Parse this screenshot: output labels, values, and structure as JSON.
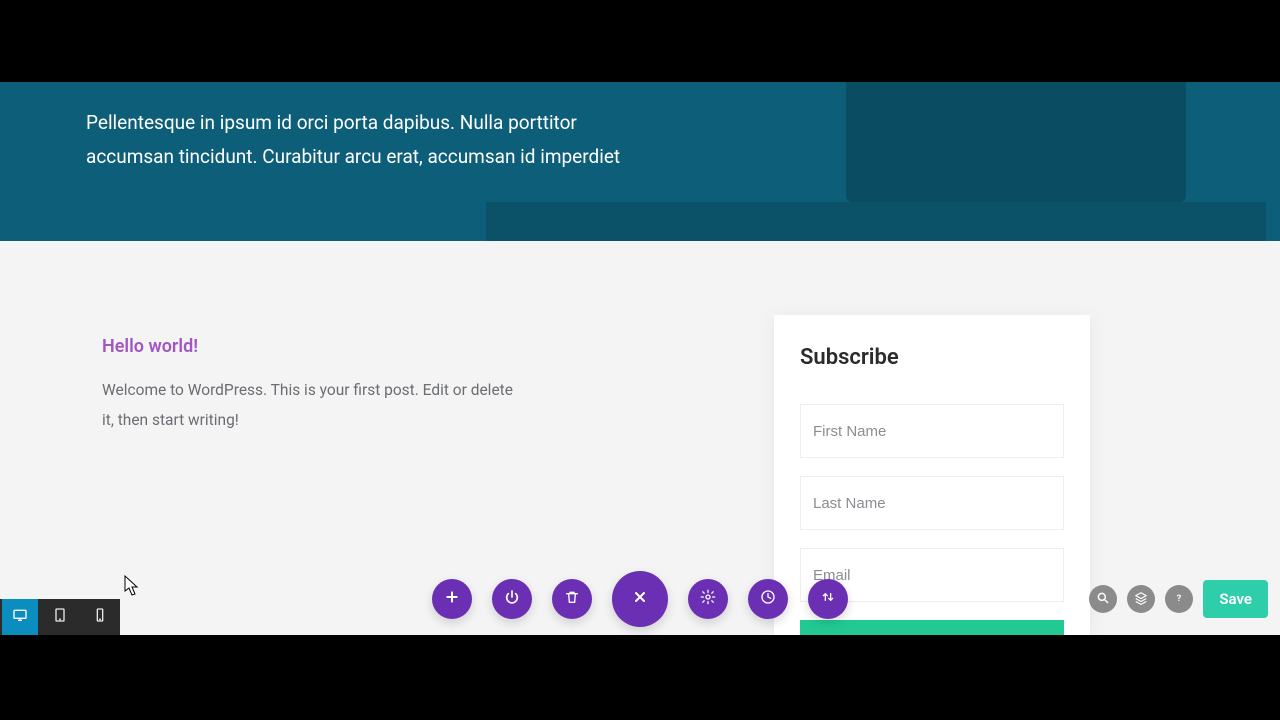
{
  "hero": {
    "paragraph": "Pellentesque in ipsum id orci porta dapibus. Nulla porttitor accumsan tincidunt. Curabitur arcu erat, accumsan id imperdiet"
  },
  "post": {
    "title": "Hello world!",
    "body": "Welcome to WordPress. This is your first post. Edit or delete it, then start writing!"
  },
  "subscribe": {
    "heading": "Subscribe",
    "fields": {
      "first_name_placeholder": "First Name",
      "last_name_placeholder": "Last Name",
      "email_placeholder": "Email"
    }
  },
  "toolbar": {
    "save_label": "Save"
  },
  "colors": {
    "purple": "#6b2fb3",
    "teal": "#2fceaa",
    "hero_bg": "#0d5e78",
    "post_title": "#a156c0"
  }
}
